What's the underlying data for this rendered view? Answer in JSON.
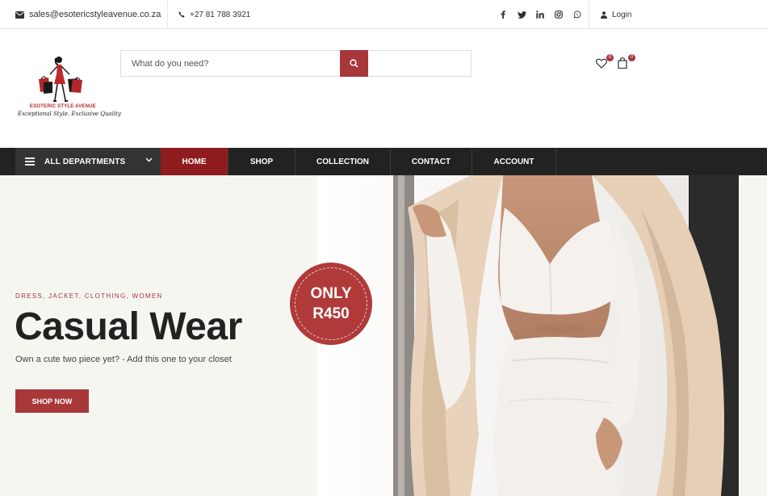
{
  "topbar": {
    "email": "sales@esotericstyleavenue.co.za",
    "phone": "+27 81 788 3921",
    "social_icons": [
      "facebook-icon",
      "twitter-icon",
      "linkedin-icon",
      "instagram-icon",
      "whatsapp-icon"
    ],
    "login_label": "Login"
  },
  "header": {
    "logo_title": "ESOTERIC STYLE AVENUE",
    "logo_tagline": "Exceptional Style. Exclusive Quality",
    "search_placeholder": "What do you need?",
    "wishlist_count": "0",
    "cart_count": "0"
  },
  "nav": {
    "departments_label": "ALL DEPARTMENTS",
    "items": [
      {
        "label": "HOME",
        "active": true
      },
      {
        "label": "SHOP",
        "active": false
      },
      {
        "label": "COLLECTION",
        "active": false
      },
      {
        "label": "CONTACT",
        "active": false
      },
      {
        "label": "ACCOUNT",
        "active": false
      }
    ]
  },
  "hero": {
    "categories": "DRESS, JACKET, CLOTHING, WOMEN",
    "title": "Casual Wear",
    "subtitle": "Own a cute two piece yet? - Add this one to your closet",
    "button_label": "SHOP NOW",
    "price_line1": "ONLY",
    "price_line2": "R450"
  },
  "colors": {
    "accent": "#a8373a",
    "nav_bg": "#222222",
    "nav_active": "#8e1c1f",
    "hero_bg": "#f6f6f0"
  }
}
